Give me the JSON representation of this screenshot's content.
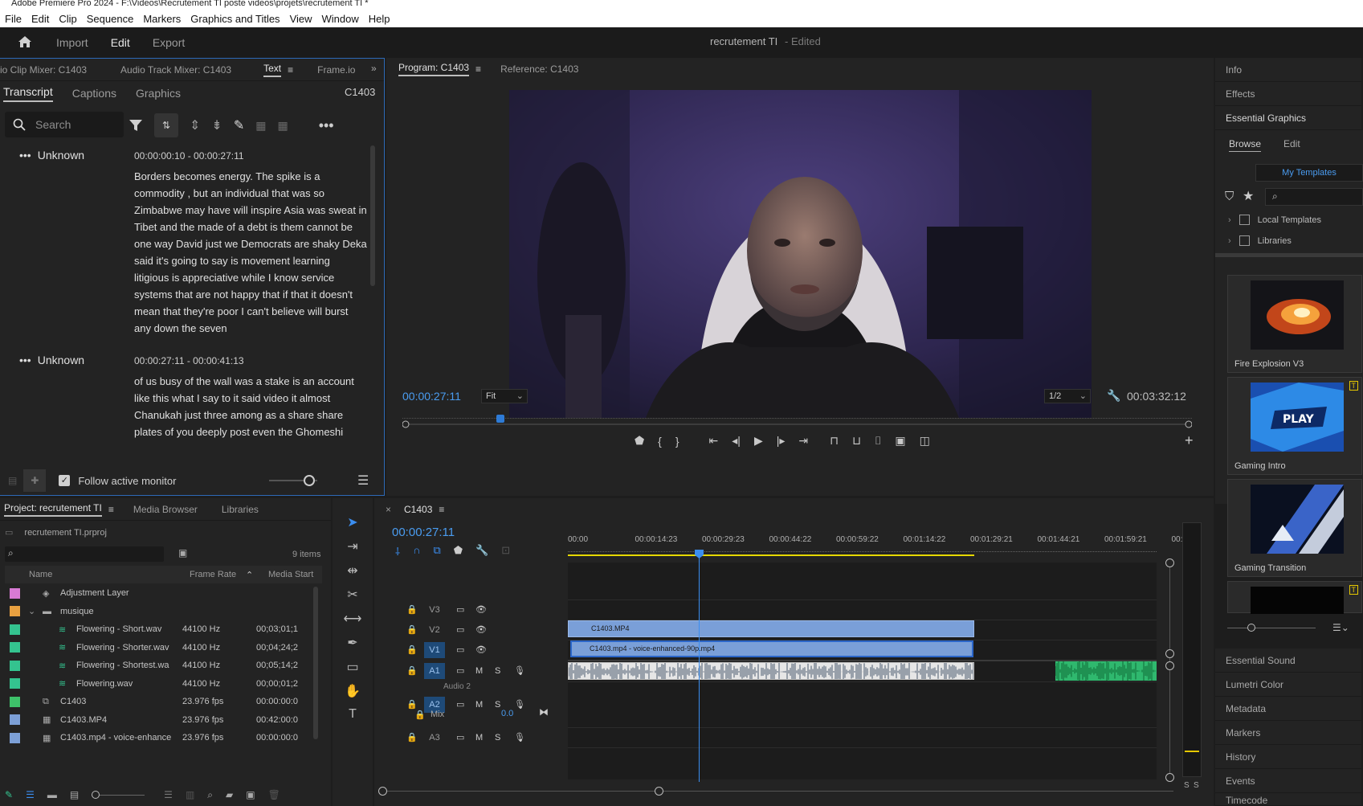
{
  "window": {
    "title": "Adobe Premiere Pro 2024 - F:\\Videos\\Recrutement TI poste videos\\projets\\recrutement TI *"
  },
  "menu": [
    "File",
    "Edit",
    "Clip",
    "Sequence",
    "Markers",
    "Graphics and Titles",
    "View",
    "Window",
    "Help"
  ],
  "header": {
    "import": "Import",
    "edit": "Edit",
    "export": "Export",
    "project_title": "recrutement TI",
    "edited": "- Edited"
  },
  "left_panel": {
    "tabs": [
      "io Clip Mixer: C1403",
      "Audio Track Mixer: C1403",
      "Text",
      "Frame.io"
    ],
    "subtabs": [
      "Transcript",
      "Captions",
      "Graphics"
    ],
    "clip": "C1403",
    "search_placeholder": "Search",
    "follow_label": "Follow active monitor",
    "segments": [
      {
        "speaker": "Unknown",
        "time": "00:00:00:10 - 00:00:27:11",
        "text": "Borders becomes energy. The spike is a commodity , but an individual that was so Zimbabwe may have will inspire Asia was sweat in Tibet and the made of a debt is them cannot be one way David just we Democrats are shaky Deka said it's going to say is movement learning litigious is appreciative while I know service systems that are not happy that if that it doesn't mean that they're poor I can't believe will burst any down the seven"
      },
      {
        "speaker": "Unknown",
        "time": "00:00:27:11 - 00:00:41:13",
        "text": "of us busy of the wall was a stake is an account like this what I say to it said video it almost Chanukah just three among as a share share plates of you deeply post even the Ghomeshi"
      }
    ]
  },
  "program_monitor": {
    "tabs": [
      "Program: C1403",
      "Reference: C1403"
    ],
    "timecode": "00:00:27:11",
    "fit": "Fit",
    "resolution": "1/2",
    "duration": "00:03:32:12",
    "playhead_fraction": 0.124
  },
  "project_panel": {
    "tabs": [
      "Project: recrutement TI",
      "Media Browser",
      "Libraries"
    ],
    "file": "recrutement TI.prproj",
    "count": "9 items",
    "columns": [
      "Name",
      "Frame Rate",
      "Media Start"
    ],
    "rows": [
      {
        "name": "Adjustment Layer",
        "rate": "",
        "start": "",
        "color": "#d87ad4",
        "icon": "adjustment-layer-icon",
        "indent": 1
      },
      {
        "name": "musique",
        "rate": "",
        "start": "",
        "color": "#e8a040",
        "icon": "folder-icon",
        "indent": 0
      },
      {
        "name": "Flowering - Short.wav",
        "rate": "44100 Hz",
        "start": "00;03;01;1",
        "color": "#34c38f",
        "icon": "audio-file-icon",
        "indent": 2
      },
      {
        "name": "Flowering - Shorter.wav",
        "rate": "44100 Hz",
        "start": "00;04;24;2",
        "color": "#34c38f",
        "icon": "audio-file-icon",
        "indent": 2
      },
      {
        "name": "Flowering - Shortest.wa",
        "rate": "44100 Hz",
        "start": "00;05;14;2",
        "color": "#34c38f",
        "icon": "audio-file-icon",
        "indent": 2
      },
      {
        "name": "Flowering.wav",
        "rate": "44100 Hz",
        "start": "00;00;01;2",
        "color": "#34c38f",
        "icon": "audio-file-icon",
        "indent": 2
      },
      {
        "name": "C1403",
        "rate": "23.976 fps",
        "start": "00:00:00:0",
        "color": "#3ec26a",
        "icon": "sequence-icon",
        "indent": 1
      },
      {
        "name": "C1403.MP4",
        "rate": "23.976 fps",
        "start": "00:42:00:0",
        "color": "#7c9fd6",
        "icon": "video-file-icon",
        "indent": 1
      },
      {
        "name": "C1403.mp4 - voice-enhance",
        "rate": "23.976 fps",
        "start": "00:00:00:0",
        "color": "#7c9fd6",
        "icon": "video-file-icon",
        "indent": 1
      }
    ]
  },
  "timeline": {
    "sequence": "C1403",
    "timecode": "00:00:27:11",
    "ruler": [
      "00:00",
      "00:00:14:23",
      "00:00:29:23",
      "00:00:44:22",
      "00:00:59:22",
      "00:01:14:22",
      "00:01:29:21",
      "00:01:44:21",
      "00:01:59:21",
      "00:0"
    ],
    "tracks": [
      "V3",
      "V2",
      "V1",
      "A1",
      "A2",
      "A3"
    ],
    "audio2_label": "Audio 2",
    "mix_label": "Mix",
    "mix_value": "0.0",
    "clips": {
      "v2": "C1403.MP4",
      "v1": "C1403.mp4 - voice-enhanced-90p.mp4"
    }
  },
  "right_panel": {
    "items_top": [
      "Info",
      "Effects",
      "Essential Graphics"
    ],
    "tabs": [
      "Browse",
      "Edit"
    ],
    "dropdown": "My Templates",
    "tree": [
      "Local Templates",
      "Libraries"
    ],
    "templates": [
      "Fire Explosion V3",
      "Gaming Intro",
      "Gaming Transition"
    ],
    "items_bottom": [
      "Essential Sound",
      "Lumetri Color",
      "Metadata",
      "Markers",
      "History",
      "Events",
      "Timecode"
    ]
  }
}
